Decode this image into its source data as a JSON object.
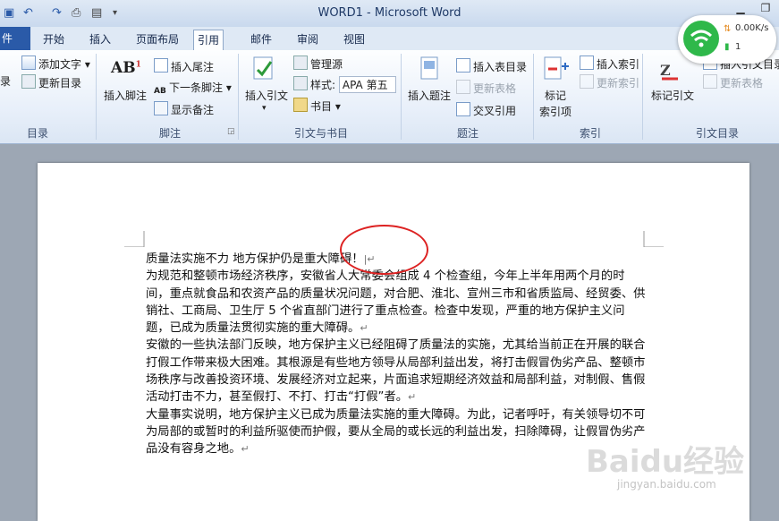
{
  "window": {
    "title": "WORD1 - Microsoft Word"
  },
  "tabs": [
    "件",
    "开始",
    "插入",
    "页面布局",
    "引用",
    "邮件",
    "审阅",
    "视图"
  ],
  "active_tab": "引用",
  "ribbon": {
    "toc": {
      "add_text": "添加文字",
      "update_toc": "更新目录",
      "toc_partial": "录",
      "group": "目录"
    },
    "footnotes": {
      "insert_footnote": "插入脚注",
      "insert_endnote": "插入尾注",
      "next_footnote": "下一条脚注",
      "show_notes": "显示备注",
      "group": "脚注",
      "ab_label": "AB"
    },
    "citations": {
      "insert_citation": "插入引文",
      "manage_sources": "管理源",
      "style_label": "样式:",
      "style_value": "APA 第五",
      "bibliography": "书目",
      "group": "引文与书目"
    },
    "captions": {
      "insert_caption": "插入题注",
      "insert_table_of_figures": "插入表目录",
      "update_table": "更新表格",
      "cross_reference": "交叉引用",
      "group": "题注"
    },
    "index": {
      "mark_entry_1": "标记",
      "mark_entry_2": "索引项",
      "insert_index": "插入索引",
      "update_index": "更新索引",
      "group": "索引"
    },
    "toa": {
      "mark_citation": "标记引文",
      "insert_toa": "插入引文目录",
      "update_table": "更新表格",
      "group": "引文目录"
    }
  },
  "network_widget": {
    "speed": "0.00K/s",
    "count": "1"
  },
  "document": {
    "title_line": "质量法实施不力 地方保护仍是重大障碍！",
    "paragraphs": [
      "为规范和整顿市场经济秩序，安徽省人大常委会组成 4 个检查组，今年上半年用两个月的时间，重点就食品和农资产品的质量状况问题，对合肥、淮北、宣州三市和省质监局、经贸委、供销社、工商局、卫生厅 5 个省直部门进行了重点检查。检查中发现，严重的地方保护主义问题，已成为质量法贯彻实施的重大障碍。",
      "安徽的一些执法部门反映，地方保护主义已经阻碍了质量法的实施，尤其给当前正在开展的联合打假工作带来极大困难。其根源是有些地方领导从局部利益出发，将打击假冒伪劣产品、整顿市场秩序与改善投资环境、发展经济对立起来，片面追求短期经济效益和局部利益，对制假、售假活动打击不力，甚至假打、不打、打击“打假”者。",
      "大量事实说明，地方保护主义已成为质量法实施的重大障碍。为此，记者呼吁，有关领导切不可为局部的或暂时的利益所驱使而护假，要从全局的或长远的利益出发，扫除障碍，让假冒伪劣产品没有容身之地。"
    ]
  },
  "watermark": {
    "logo": "Baidu经验",
    "url": "jingyan.baidu.com"
  }
}
